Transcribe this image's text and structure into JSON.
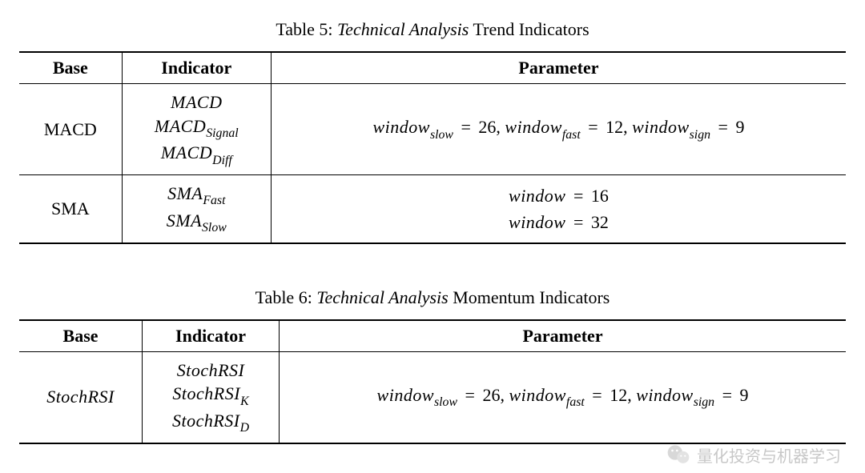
{
  "table5": {
    "caption_label": "Table 5: ",
    "caption_emph": "Technical Analysis",
    "caption_tail": " Trend Indicators",
    "headers": {
      "base": "Base",
      "indicator": "Indicator",
      "parameter": "Parameter"
    },
    "rows": {
      "macd": {
        "base": "MACD",
        "indicators": {
          "a": "MACD",
          "b_main": "MACD",
          "b_sub": "Signal",
          "c_main": "MACD",
          "c_sub": "Diff"
        },
        "param": {
          "w1_main": "window",
          "w1_sub": "slow",
          "w1_val": "26",
          "w2_main": "window",
          "w2_sub": "fast",
          "w2_val": "12",
          "w3_main": "window",
          "w3_sub": "sign",
          "w3_val": "9",
          "eq": " = ",
          "comma": ", "
        }
      },
      "sma": {
        "base": "SMA",
        "indicators": {
          "a_main": "SMA",
          "a_sub": "Fast",
          "b_main": "SMA",
          "b_sub": "Slow"
        },
        "params": {
          "p1_main": "window",
          "p1_val": "16",
          "p2_main": "window",
          "p2_val": "32",
          "eq": " = "
        }
      }
    }
  },
  "table6": {
    "caption_label": "Table 6: ",
    "caption_emph": "Technical Analysis",
    "caption_tail": " Momentum Indicators",
    "headers": {
      "base": "Base",
      "indicator": "Indicator",
      "parameter": "Parameter"
    },
    "rows": {
      "stochrsi": {
        "base_main": "StochRSI",
        "indicators": {
          "a": "StochRSI",
          "b_main": "StochRSI",
          "b_sub": "K",
          "c_main": "StochRSI",
          "c_sub": "D"
        },
        "param": {
          "w1_main": "window",
          "w1_sub": "slow",
          "w1_val": "26",
          "w2_main": "window",
          "w2_sub": "fast",
          "w2_val": "12",
          "w3_main": "window",
          "w3_sub": "sign",
          "w3_val": "9",
          "eq": " = ",
          "comma": ", "
        }
      }
    }
  },
  "watermark": {
    "text": "量化投资与机器学习"
  }
}
